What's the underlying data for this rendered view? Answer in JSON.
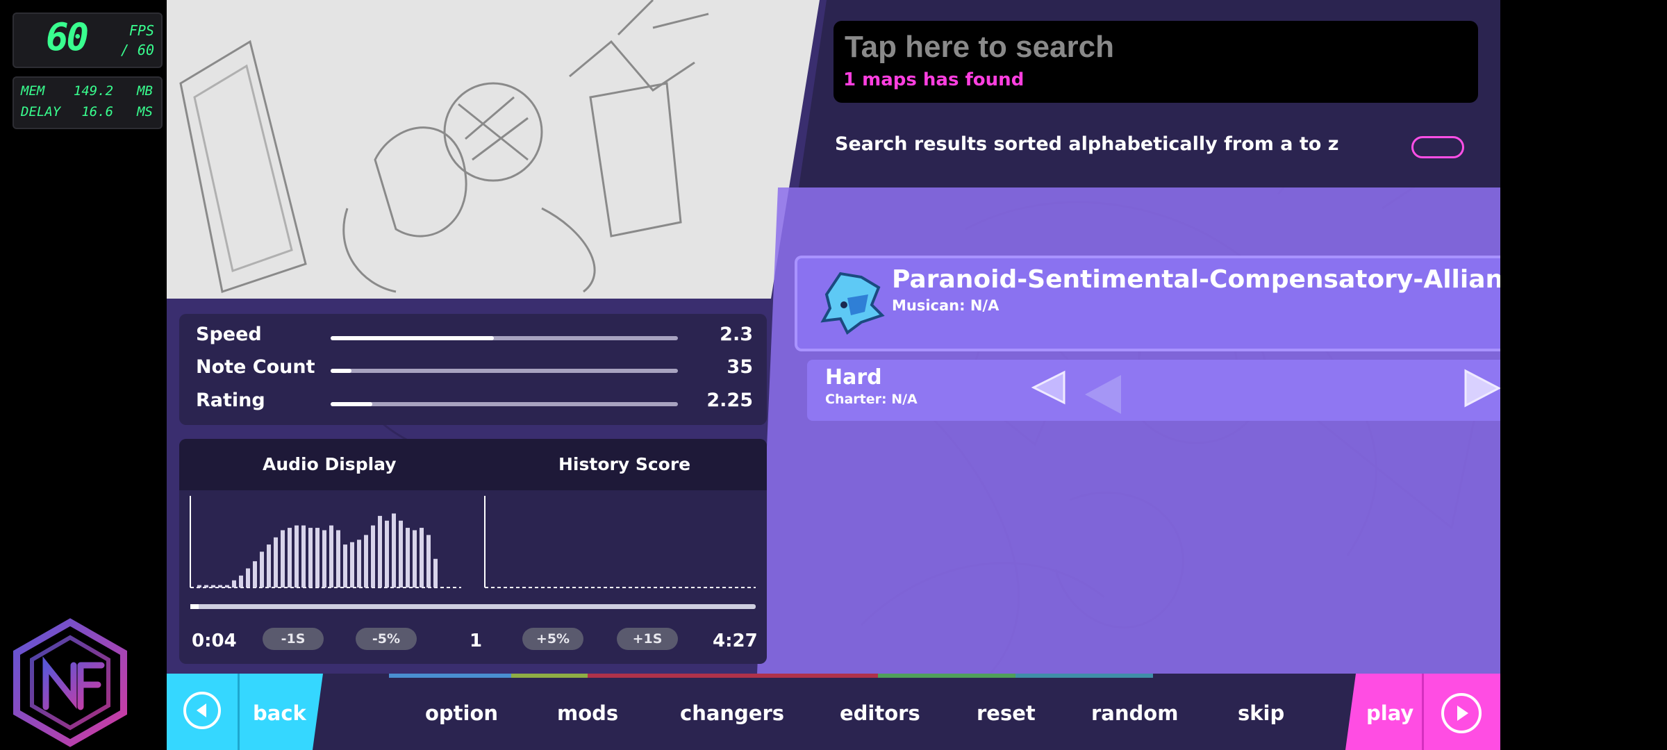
{
  "perf": {
    "fps": "60",
    "fps_label": "FPS",
    "fps_max": "/ 60",
    "mem_label": "MEM",
    "mem_value": "149.2",
    "mem_unit": "MB",
    "delay_label": "DELAY",
    "delay_value": "16.6",
    "delay_unit": "MS"
  },
  "search": {
    "placeholder": "Tap here to search",
    "result_count": "1 maps has found"
  },
  "sort": {
    "label": "Search results sorted alphabetically from a to z",
    "toggle_on": false
  },
  "song": {
    "title": "Paranoid-Sentimental-Compensatory-Allianc",
    "musician": "Musican: N/A"
  },
  "difficulty": {
    "name": "Hard",
    "charter": "Charter: N/A"
  },
  "stats": [
    {
      "label": "Speed",
      "value": "2.3",
      "fill": 0.47
    },
    {
      "label": "Note Count",
      "value": "35",
      "fill": 0.06
    },
    {
      "label": "Rating",
      "value": "2.25",
      "fill": 0.12
    }
  ],
  "audio": {
    "title_left": "Audio Display",
    "title_right": "History Score",
    "time_current": "0:04",
    "minus_1s": "-1S",
    "minus_5p": "-5%",
    "rate": "1",
    "plus_5p": "+5%",
    "plus_1s": "+1S",
    "time_total": "4:27",
    "progress": 0.015,
    "bars": [
      1,
      1,
      1,
      1,
      1,
      3,
      5,
      8,
      11,
      15,
      18,
      21,
      24,
      25,
      26,
      26,
      25,
      25,
      24,
      26,
      24,
      18,
      19,
      20,
      22,
      26,
      30,
      28,
      31,
      28,
      25,
      24,
      25,
      22,
      12
    ]
  },
  "nav": {
    "back": "back",
    "option": "option",
    "mods": "mods",
    "changers": "changers",
    "editors": "editors",
    "reset": "reset",
    "random": "random",
    "skip": "skip",
    "play": "play"
  },
  "colors": {
    "accent_cyan": "#35d7ff",
    "accent_pink": "#ff4de3",
    "panel": "#2b2450",
    "song_panel": "#8a72f0",
    "perf_green": "#39ff8f"
  }
}
